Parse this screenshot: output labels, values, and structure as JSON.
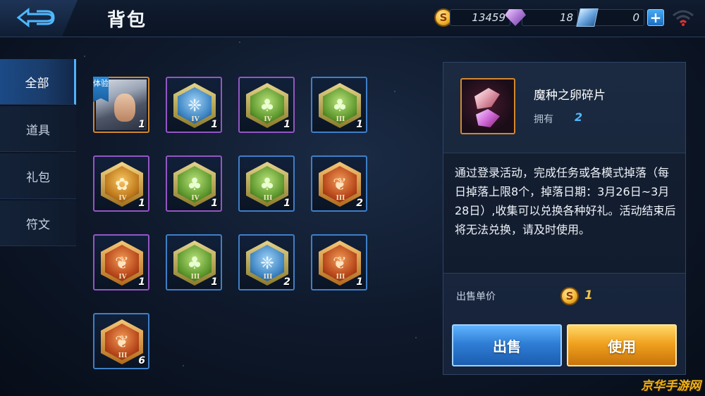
{
  "header": {
    "title": "背包",
    "gold": "13459",
    "diamonds": "18",
    "crystals": "0",
    "plus_label": "+"
  },
  "tabs": [
    {
      "label": "全部",
      "active": true
    },
    {
      "label": "道具",
      "active": false
    },
    {
      "label": "礼包",
      "active": false
    },
    {
      "label": "符文",
      "active": false
    }
  ],
  "items": [
    {
      "kind": "hero",
      "rarity": "orange",
      "tag": "体验",
      "count": "1"
    },
    {
      "kind": "rune",
      "rarity": "purple",
      "theme": "blue",
      "tier": "IV",
      "count": "1"
    },
    {
      "kind": "rune",
      "rarity": "purple",
      "theme": "green",
      "tier": "IV",
      "count": "1"
    },
    {
      "kind": "rune",
      "rarity": "blue",
      "theme": "green",
      "tier": "III",
      "count": "1"
    },
    {
      "kind": "rune",
      "rarity": "purple",
      "theme": "gold",
      "tier": "IV",
      "count": "1"
    },
    {
      "kind": "rune",
      "rarity": "purple",
      "theme": "green",
      "tier": "IV",
      "count": "1"
    },
    {
      "kind": "rune",
      "rarity": "blue",
      "theme": "green",
      "tier": "III",
      "count": "1"
    },
    {
      "kind": "rune",
      "rarity": "blue",
      "theme": "orange",
      "tier": "III",
      "count": "2"
    },
    {
      "kind": "rune",
      "rarity": "purple",
      "theme": "orange",
      "tier": "IV",
      "count": "1"
    },
    {
      "kind": "rune",
      "rarity": "blue",
      "theme": "green",
      "tier": "III",
      "count": "1"
    },
    {
      "kind": "rune",
      "rarity": "blue",
      "theme": "blue",
      "tier": "III",
      "count": "2"
    },
    {
      "kind": "rune",
      "rarity": "blue",
      "theme": "orange",
      "tier": "III",
      "count": "1"
    },
    {
      "kind": "rune",
      "rarity": "blue",
      "theme": "orange",
      "tier": "III",
      "count": "6"
    }
  ],
  "detail": {
    "name": "魔种之卵碎片",
    "own_label": "拥有",
    "own_count": "2",
    "description": "通过登录活动，完成任务或各模式掉落（每日掉落上限8个，掉落日期：3月26日~3月28日）,收集可以兑换各种好礼。活动结束后将无法兑换，请及时使用。",
    "price_label": "出售单价",
    "price_value": "1",
    "sell_label": "出售",
    "use_label": "使用"
  },
  "watermark": "京华手游网",
  "colors": {
    "rarity_orange": "#d4872e",
    "rarity_purple": "#9456c4",
    "rarity_blue": "#3f7fc7",
    "accent_blue": "#4fb9ff",
    "accent_gold": "#f3c347"
  }
}
